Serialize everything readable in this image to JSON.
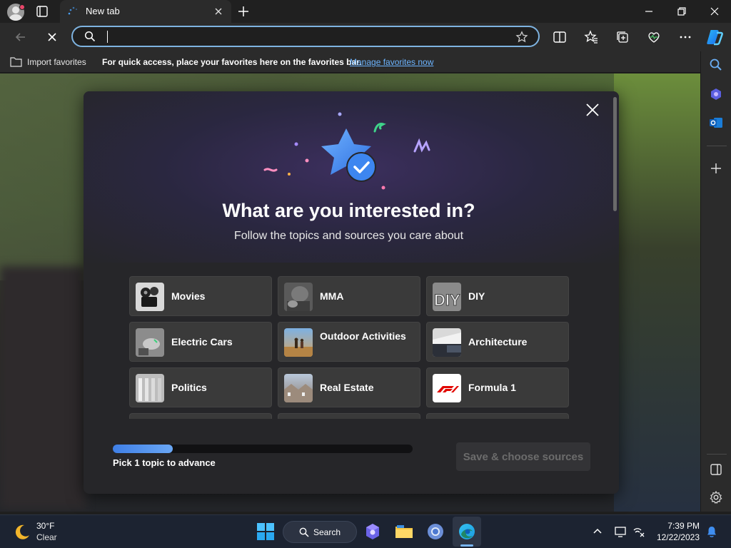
{
  "browser": {
    "tab_title": "New tab",
    "address_value": "",
    "address_placeholder": ""
  },
  "favorites_bar": {
    "import_label": "Import favorites",
    "hint": "For quick access, place your favorites here on the favorites bar.",
    "manage_link": "Manage favorites now"
  },
  "modal": {
    "title": "What are you interested in?",
    "subtitle": "Follow the topics and sources you care about",
    "topics": [
      {
        "label": "Movies"
      },
      {
        "label": "MMA"
      },
      {
        "label": "DIY"
      },
      {
        "label": "Electric Cars"
      },
      {
        "label": "Outdoor Activities"
      },
      {
        "label": "Architecture"
      },
      {
        "label": "Politics"
      },
      {
        "label": "Real Estate"
      },
      {
        "label": "Formula 1"
      }
    ],
    "progress_label": "Pick 1 topic to advance",
    "progress_fraction": 0.2,
    "save_button": "Save & choose sources"
  },
  "taskbar": {
    "weather_temp": "30°F",
    "weather_condition": "Clear",
    "search_label": "Search",
    "time": "7:39 PM",
    "date": "12/22/2023"
  },
  "colors": {
    "accent": "#3f7fe6",
    "link": "#6cb4ff",
    "address_border": "#7eb3e0"
  }
}
